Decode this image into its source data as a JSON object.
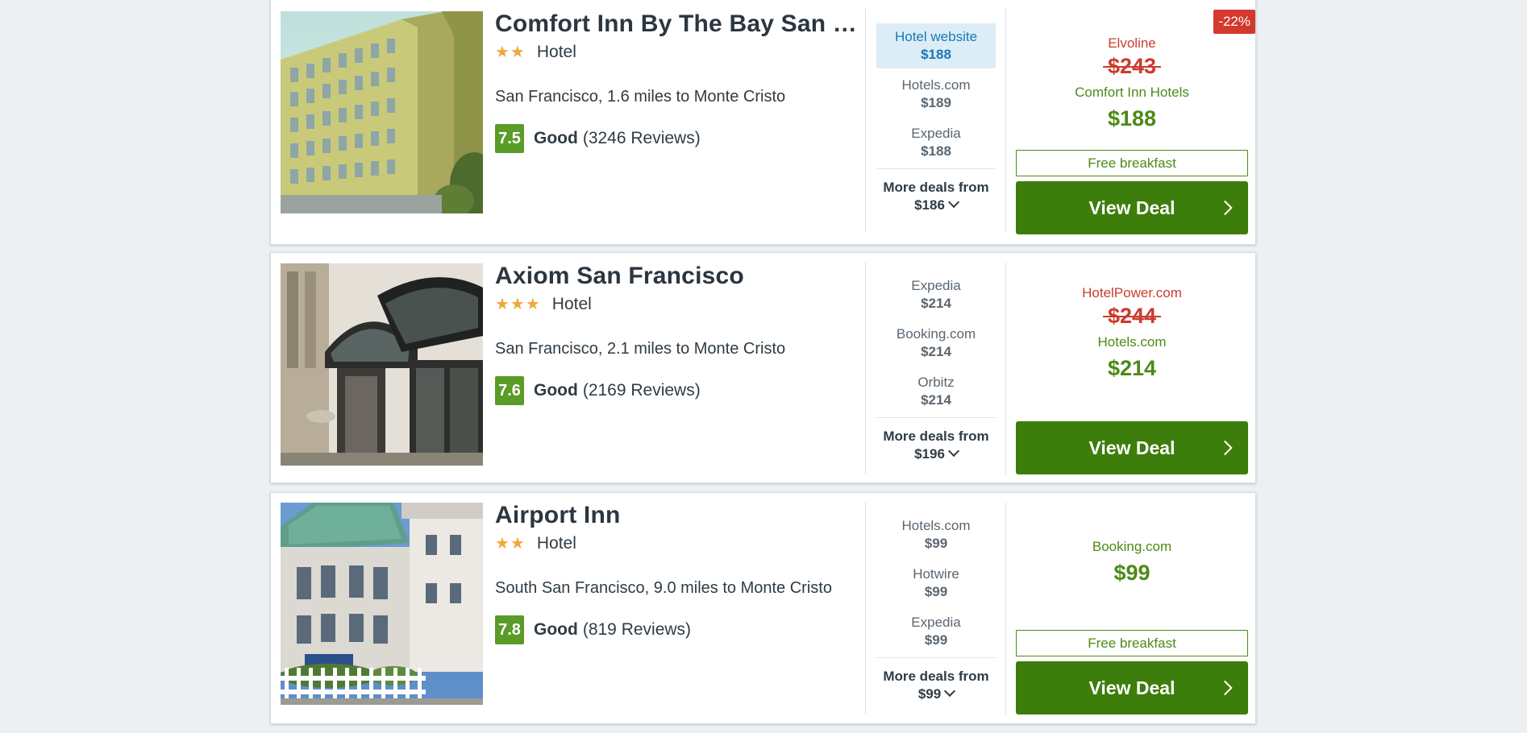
{
  "listings": [
    {
      "name": "Comfort Inn By The Bay San …",
      "stars": "★★",
      "type": "Hotel",
      "location": "San Francisco, 1.6 miles to Monte Cristo",
      "score": "7.5",
      "rating_word": "Good",
      "reviews": "(3246 Reviews)",
      "providers": [
        {
          "name": "Hotel website",
          "price": "$188",
          "highlighted": true
        },
        {
          "name": "Hotels.com",
          "price": "$189",
          "highlighted": false
        },
        {
          "name": "Expedia",
          "price": "$188",
          "highlighted": false
        }
      ],
      "more_deals_label": "More deals from",
      "more_deals_price": "$186",
      "discount": "-22%",
      "offer_old_vendor": "Elvoline",
      "offer_old_price": "$243",
      "offer_vendor": "Comfort Inn Hotels",
      "offer_price": "$188",
      "perk": "Free breakfast",
      "button_label": "View Deal"
    },
    {
      "name": "Axiom San Francisco",
      "stars": "★★★",
      "type": "Hotel",
      "location": "San Francisco, 2.1 miles to Monte Cristo",
      "score": "7.6",
      "rating_word": "Good",
      "reviews": "(2169 Reviews)",
      "providers": [
        {
          "name": "Expedia",
          "price": "$214",
          "highlighted": false
        },
        {
          "name": "Booking.com",
          "price": "$214",
          "highlighted": false
        },
        {
          "name": "Orbitz",
          "price": "$214",
          "highlighted": false
        }
      ],
      "more_deals_label": "More deals from",
      "more_deals_price": "$196",
      "offer_old_vendor": "HotelPower.com",
      "offer_old_price": "$244",
      "offer_vendor": "Hotels.com",
      "offer_price": "$214",
      "button_label": "View Deal"
    },
    {
      "name": "Airport Inn",
      "stars": "★★",
      "type": "Hotel",
      "location": "South San Francisco, 9.0 miles to Monte Cristo",
      "score": "7.8",
      "rating_word": "Good",
      "reviews": "(819 Reviews)",
      "providers": [
        {
          "name": "Hotels.com",
          "price": "$99",
          "highlighted": false
        },
        {
          "name": "Hotwire",
          "price": "$99",
          "highlighted": false
        },
        {
          "name": "Expedia",
          "price": "$99",
          "highlighted": false
        }
      ],
      "more_deals_label": "More deals from",
      "more_deals_price": "$99",
      "offer_vendor": "Booking.com",
      "offer_price": "$99",
      "perk": "Free breakfast",
      "button_label": "View Deal"
    }
  ],
  "colors": {
    "page_bg": "#edf0f3",
    "score_green": "#5b9b28",
    "deal_green": "#4d8a16",
    "button_green": "#3c7d0b",
    "old_price_red": "#cc3b2e",
    "highlight_blue": "#1a78b4",
    "highlight_bg": "#dcedf7",
    "star_orange": "#f1a83a"
  }
}
